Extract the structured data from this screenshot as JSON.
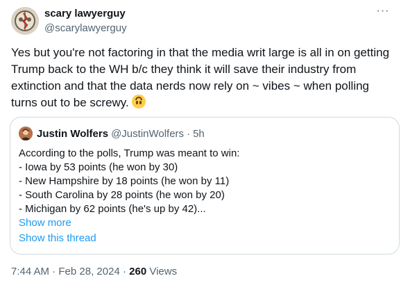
{
  "author": {
    "name": "scary lawyerguy",
    "handle": "@scarylawyerguy",
    "avatar_icon": "steal-your-face-skull-icon"
  },
  "more_icon": "more-horizontal-icon",
  "tweet": {
    "text": "Yes but you're not factoring in that the media writ large is all in on getting Trump back to the WH b/c they think it will save their industry from extinction and that the data nerds now rely on ~ vibes ~ when polling turns out to be screwy.",
    "emoji": "upside-down-face"
  },
  "quote": {
    "name": "Justin Wolfers",
    "handle": "@JustinWolfers",
    "separator": "·",
    "time": "5h",
    "lines": [
      "According to the polls, Trump was meant to win:",
      "- Iowa by 53 points (he won by 30)",
      "- New Hampshire by 18 points (he won by 11)",
      "- South Carolina by 28 points (he won by 20)",
      "- Michigan by 62 points (he's up by 42)..."
    ],
    "show_more": "Show more",
    "show_thread": "Show this thread"
  },
  "footer": {
    "time": "7:44 AM",
    "separator": "·",
    "date": "Feb 28, 2024",
    "separator2": "·",
    "views_count": "260",
    "views_label": "Views"
  },
  "colors": {
    "link": "#1d9bf0",
    "secondary_text": "#536471",
    "border": "#cfd9de"
  }
}
